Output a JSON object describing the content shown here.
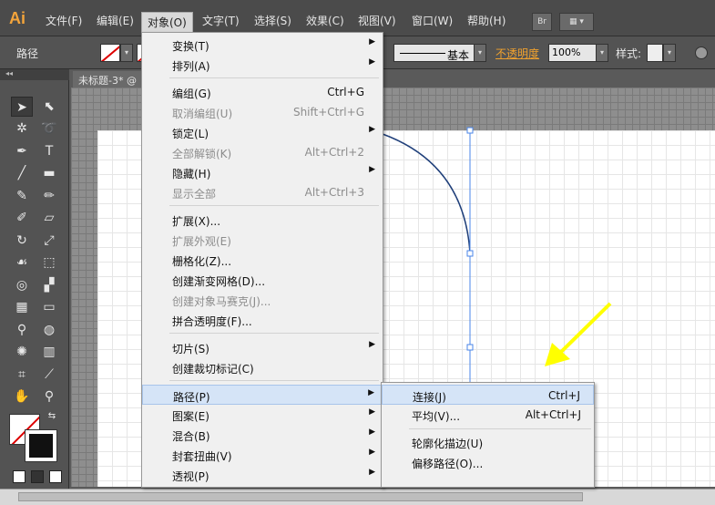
{
  "menubar": {
    "logo": "Ai",
    "items": [
      "文件(F)",
      "编辑(E)",
      "对象(O)",
      "文字(T)",
      "选择(S)",
      "效果(C)",
      "视图(V)",
      "窗口(W)",
      "帮助(H)"
    ],
    "br_button": "Br"
  },
  "controlbar": {
    "label": "路径",
    "stroke_style": "基本",
    "opacity_label": "不透明度",
    "opacity_value": "100%",
    "style_label": "样式:"
  },
  "document": {
    "tab_title": "未标题-3* @"
  },
  "object_menu": {
    "items": [
      {
        "label": "变换(T)",
        "submenu": true
      },
      {
        "label": "排列(A)",
        "submenu": true
      },
      {
        "label": "编组(G)",
        "shortcut": "Ctrl+G"
      },
      {
        "label": "取消编组(U)",
        "shortcut": "Shift+Ctrl+G",
        "disabled": true
      },
      {
        "label": "锁定(L)",
        "submenu": true
      },
      {
        "label": "全部解锁(K)",
        "shortcut": "Alt+Ctrl+2",
        "disabled": true
      },
      {
        "label": "隐藏(H)",
        "submenu": true
      },
      {
        "label": "显示全部",
        "shortcut": "Alt+Ctrl+3",
        "disabled": true
      },
      {
        "label": "扩展(X)..."
      },
      {
        "label": "扩展外观(E)",
        "disabled": true
      },
      {
        "label": "栅格化(Z)..."
      },
      {
        "label": "创建渐变网格(D)..."
      },
      {
        "label": "创建对象马赛克(J)...",
        "disabled": true
      },
      {
        "label": "拼合透明度(F)..."
      },
      {
        "label": "切片(S)",
        "submenu": true
      },
      {
        "label": "创建裁切标记(C)"
      },
      {
        "label": "路径(P)",
        "submenu": true,
        "highlighted": true
      },
      {
        "label": "图案(E)",
        "submenu": true
      },
      {
        "label": "混合(B)",
        "submenu": true
      },
      {
        "label": "封套扭曲(V)",
        "submenu": true
      },
      {
        "label": "透视(P)",
        "submenu": true
      }
    ]
  },
  "path_submenu": {
    "items": [
      {
        "label": "连接(J)",
        "shortcut": "Ctrl+J",
        "highlighted": true
      },
      {
        "label": "平均(V)...",
        "shortcut": "Alt+Ctrl+J"
      },
      {
        "label": "轮廓化描边(U)"
      },
      {
        "label": "偏移路径(O)..."
      }
    ]
  },
  "colors": {
    "accent": "#f3a43b",
    "highlight": "#d5e4f7",
    "arrow": "#ffff00",
    "path": "#1f3f7a"
  }
}
